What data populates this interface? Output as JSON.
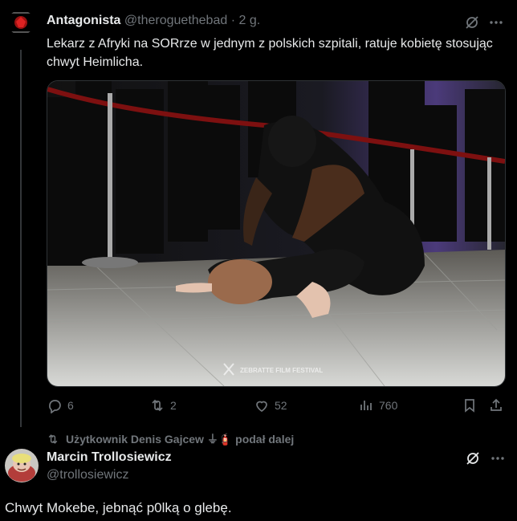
{
  "tweet1": {
    "author_name": "Antagonista",
    "author_handle": "@theroguethebad",
    "separator": "·",
    "time": "2 g.",
    "text": "Lekarz z Afryki na SORrze w jednym z polskich szpitali, ratuje kobietę stosując chwyt Heimlicha.",
    "media_watermark": "ZEBRATTE FILM FESTIVAL",
    "stats": {
      "replies": "6",
      "reposts": "2",
      "likes": "52",
      "views": "760"
    },
    "icons": {
      "grok": "grok-icon",
      "more": "more-icon",
      "reply": "reply-icon",
      "repost": "repost-icon",
      "like": "heart-icon",
      "views": "views-icon",
      "bookmark": "bookmark-icon",
      "share": "share-icon"
    }
  },
  "repost_notice": {
    "text": "Użytkownik Denis Gajcew ⏚🧯 podał dalej"
  },
  "tweet2": {
    "author_name": "Marcin Trollosiewicz",
    "author_handle": "@trollosiewicz",
    "text": "Chwyt Mokebe, jebnąć p0lką o glebę."
  },
  "colors": {
    "background": "#000000",
    "text_primary": "#e7e9ea",
    "text_secondary": "#71767b",
    "divider": "#333639"
  }
}
